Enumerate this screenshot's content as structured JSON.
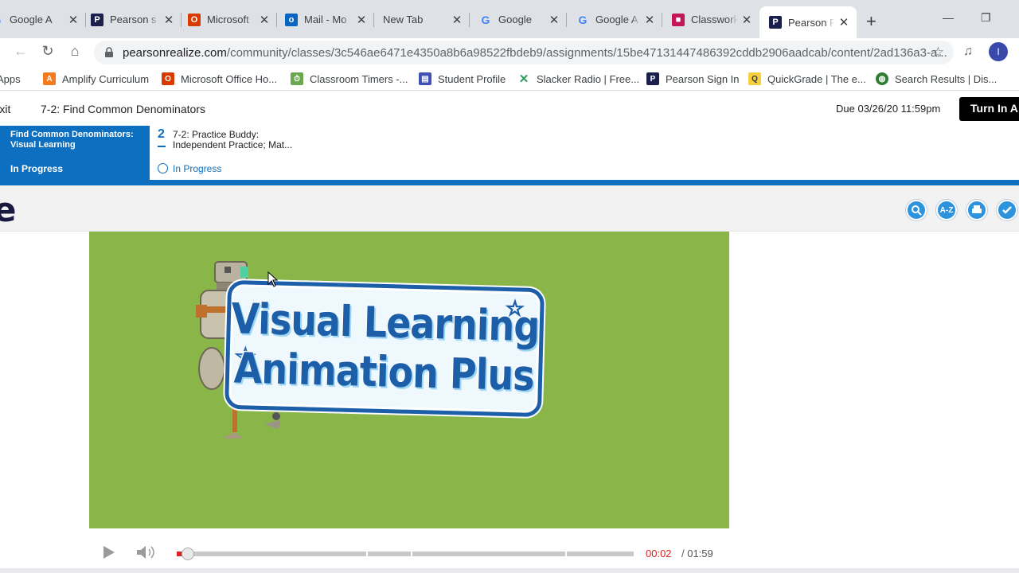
{
  "tabs": [
    {
      "title": "Google A",
      "icon": "google-icon",
      "active": false
    },
    {
      "title": "Pearson s",
      "icon": "pearson-icon",
      "active": false
    },
    {
      "title": "Microsoft",
      "icon": "office-icon",
      "active": false
    },
    {
      "title": "Mail - Mo",
      "icon": "outlook-icon",
      "active": false
    },
    {
      "title": "New Tab",
      "icon": "",
      "active": false
    },
    {
      "title": "Google",
      "icon": "google-icon",
      "active": false
    },
    {
      "title": "Google A",
      "icon": "google-icon",
      "active": false
    },
    {
      "title": "Classwork",
      "icon": "classroom-icon",
      "active": false
    },
    {
      "title": "Pearson R",
      "icon": "pearson-icon",
      "active": true
    }
  ],
  "address": {
    "domain": "pearsonrealize.com",
    "path": "/community/classes/3c546ae6471e4350a8b6a98522fbdeb9/assignments/15be47131447486392cddb2906aadcab/content/2ad136a3-a..."
  },
  "profile_initial": "I",
  "bookmarks": [
    {
      "label": "Apps",
      "icon": "apps-grid-icon"
    },
    {
      "label": "Amplify Curriculum",
      "icon": "amplify-icon"
    },
    {
      "label": "Microsoft Office Ho...",
      "icon": "office-icon"
    },
    {
      "label": "Classroom Timers -...",
      "icon": "timer-icon"
    },
    {
      "label": "Student Profile",
      "icon": "profile-icon"
    },
    {
      "label": "Slacker Radio | Free...",
      "icon": "slacker-icon"
    },
    {
      "label": "Pearson Sign In",
      "icon": "pearson-icon"
    },
    {
      "label": "QuickGrade | The e...",
      "icon": "quickgrade-icon"
    },
    {
      "label": "Search Results | Dis...",
      "icon": "globe-icon"
    }
  ],
  "assignment": {
    "exit": "Exit",
    "title": "7-2: Find Common Denominators",
    "due": "Due 03/26/20 11:59pm",
    "turn_in": "Turn In A"
  },
  "steps": [
    {
      "name": "Find Common Denominators: Visual Learning",
      "status": "In Progress"
    },
    {
      "number": "2",
      "name": "7-2: Practice Buddy: Independent Practice; Mat...",
      "status": "In Progress"
    }
  ],
  "tool_icons": [
    "glossary-search-icon",
    "a-z-icon",
    "print-icon",
    "check-icon"
  ],
  "tool_labels": {
    "a_z": "A-Z"
  },
  "video": {
    "line1": "Visual Learning",
    "line2": "Animation Plus",
    "current_time": "00:02",
    "total_time": "/ 01:59",
    "progress": 0.017,
    "colors": {
      "background": "#8ab549",
      "sign_border": "#1d5ea8"
    }
  }
}
